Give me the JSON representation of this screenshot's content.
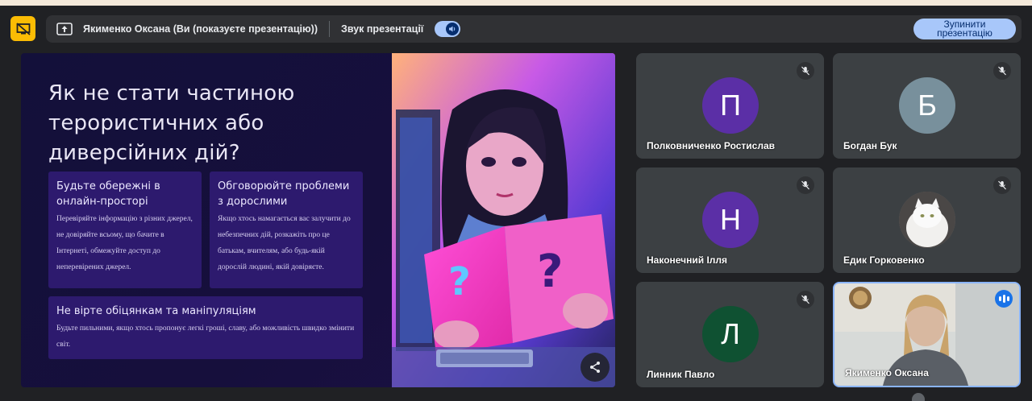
{
  "banner": {
    "presenter_text": "Якименко Оксана (Ви (показуєте презентацію))",
    "sound_label": "Звук презентації",
    "sound_on": true,
    "stop_button": "Зупинити презентацію"
  },
  "slide": {
    "title": "Як не стати частиною терористичних або диверсійних дій?",
    "cards": [
      {
        "heading": "Будьте обережні в онлайн-просторі",
        "text": "Перевіряйте інформацію з різних джерел, не довіряйте всьому, що бачите в Інтернеті, обмежуйте доступ до неперевірених джерел."
      },
      {
        "heading": "Обговорюйте проблеми з дорослими",
        "text": "Якщо хтось намагається вас залучити до небезпечних дій, розкажіть про це батькам, вчителям, або будь-якій дорослій людині, якій довіряєте."
      },
      {
        "heading": "Не вірте обіцянкам та маніпуляціям",
        "text": "Будьте пильними, якщо хтось пропонує легкі гроші, славу, або можливість швидко змінити світ."
      }
    ]
  },
  "participants": [
    {
      "initial": "П",
      "name": "Полковниченко Ростислав",
      "avatar_color": "#5b2fa6",
      "muted": true
    },
    {
      "initial": "Б",
      "name": "Богдан Бук",
      "avatar_color": "#78909c",
      "muted": true
    },
    {
      "initial": "Н",
      "name": "Наконечний Ілля",
      "avatar_color": "#5b2fa6",
      "muted": true
    },
    {
      "initial": "",
      "name": "Едик Горковенко",
      "avatar_color": "#e8e8e8",
      "muted": true
    },
    {
      "initial": "Л",
      "name": "Линник Павло",
      "avatar_color": "#0f5132",
      "muted": true
    },
    {
      "initial": "",
      "name": "Якименко Оксана",
      "avatar_color": "",
      "muted": false,
      "speaking": true
    }
  ],
  "icons": {
    "badge": "present-off-icon",
    "banner": "present-to-all-icon",
    "toggle": "volume-icon",
    "share": "share-icon",
    "mic": "mic-off-icon"
  }
}
